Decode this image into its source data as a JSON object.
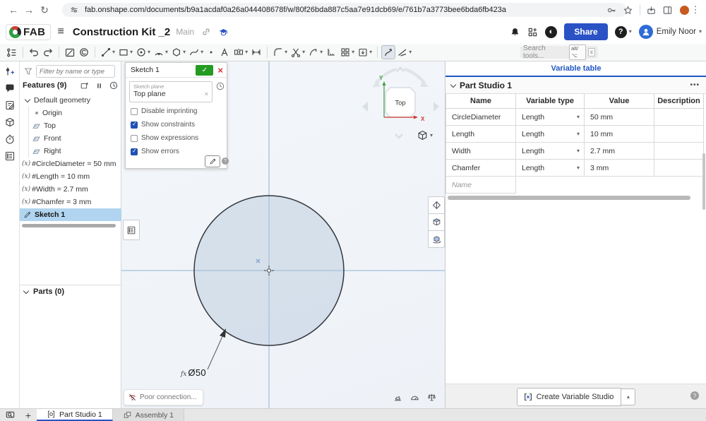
{
  "browser": {
    "url": "fab.onshape.com/documents/b9a1acdaf0a26a044408678f/w/80f26bda887c5aa7e91dcb69/e/761b7a3773bee6bda6fb423a"
  },
  "header": {
    "brand": "FAB",
    "title": "Construction Kit _2",
    "workspace": "Main",
    "share_label": "Share",
    "user_name": "Emily Noor"
  },
  "toolbar": {
    "search_placeholder": "Search tools...",
    "shortcut_alt": "alt/⌥",
    "shortcut_key": "c"
  },
  "features_panel": {
    "filter_placeholder": "Filter by name or type",
    "header": "Features (9)",
    "tree": [
      {
        "label": "Default geometry",
        "type": "group"
      },
      {
        "label": "Origin",
        "type": "origin"
      },
      {
        "label": "Top",
        "type": "plane"
      },
      {
        "label": "Front",
        "type": "plane"
      },
      {
        "label": "Right",
        "type": "plane"
      },
      {
        "label": "#CircleDiameter = 50 mm",
        "type": "variable"
      },
      {
        "label": "#Length = 10 mm",
        "type": "variable"
      },
      {
        "label": "#Width = 2.7 mm",
        "type": "variable"
      },
      {
        "label": "#Chamfer = 3 mm",
        "type": "variable"
      },
      {
        "label": "Sketch 1",
        "type": "sketch",
        "selected": true
      }
    ],
    "parts_header": "Parts (0)"
  },
  "sketch_dialog": {
    "title": "Sketch 1",
    "plane_label": "Sketch plane",
    "plane_value": "Top plane",
    "options": [
      {
        "label": "Disable imprinting",
        "checked": false
      },
      {
        "label": "Show constraints",
        "checked": true
      },
      {
        "label": "Show expressions",
        "checked": false
      },
      {
        "label": "Show errors",
        "checked": true
      }
    ]
  },
  "canvas": {
    "view_cube": {
      "label": "Top",
      "x_axis": "X",
      "y_axis": "Y"
    },
    "dimension": {
      "prefix": "fx",
      "value": "Ø50"
    },
    "toast": "Poor connection..."
  },
  "variable_table": {
    "tab_label": "Variable table",
    "section": "Part Studio 1",
    "columns": [
      "Name",
      "Variable type",
      "Value",
      "Description"
    ],
    "rows": [
      {
        "name": "CircleDiameter",
        "type": "Length",
        "value": "50 mm",
        "description": ""
      },
      {
        "name": "Length",
        "type": "Length",
        "value": "10 mm",
        "description": ""
      },
      {
        "name": "Width",
        "type": "Length",
        "value": "2.7 mm",
        "description": ""
      },
      {
        "name": "Chamfer",
        "type": "Length",
        "value": "3 mm",
        "description": ""
      }
    ],
    "new_row_placeholder": "Name",
    "create_button": "Create Variable Studio"
  },
  "bottom_bar": {
    "tabs": [
      {
        "label": "Part Studio 1",
        "active": true
      },
      {
        "label": "Assembly 1",
        "active": false
      }
    ]
  },
  "icons": {
    "caret_down": "▾",
    "caret_up": "▴",
    "kebab": "⋮",
    "ellipsis": "•••",
    "check": "✓",
    "close": "×",
    "plus": "+",
    "back": "←",
    "forward": "→",
    "reload": "↻",
    "variable": "(x)",
    "help": "?"
  },
  "colors": {
    "accent_blue": "#2a52c4",
    "table_blue": "#1f56c4",
    "selection_blue": "#b1d5f0",
    "confirm_green": "#259b24",
    "cancel_red": "#d3302f",
    "axis_blue": "#8fb2d4"
  }
}
